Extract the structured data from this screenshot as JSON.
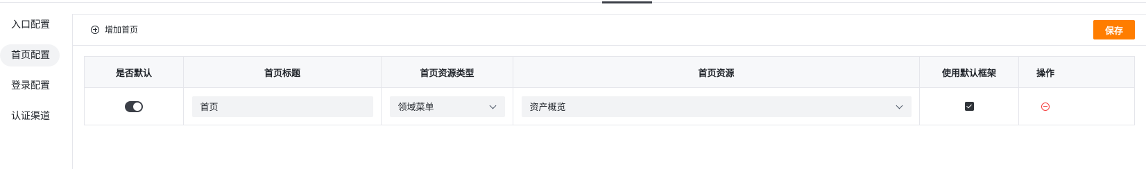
{
  "sidebar": {
    "items": [
      {
        "label": "入口配置"
      },
      {
        "label": "首页配置"
      },
      {
        "label": "登录配置"
      },
      {
        "label": "认证渠道"
      }
    ]
  },
  "toolbar": {
    "add_label": "增加首页",
    "save_label": "保存"
  },
  "table": {
    "columns": [
      "是否默认",
      "首页标题",
      "首页资源类型",
      "首页资源",
      "使用默认框架",
      "操作"
    ],
    "rows": [
      {
        "is_default": true,
        "title": "首页",
        "resource_type": "领域菜单",
        "resource": "资产概览",
        "use_default_frame": true
      }
    ]
  },
  "colors": {
    "accent": "#ff7d00",
    "danger": "#f53f3f",
    "switch_on": "#3b3f47"
  },
  "icons": {
    "add": "plus-circle-icon",
    "remove": "minus-circle-icon",
    "dropdown": "chevron-down-icon"
  }
}
